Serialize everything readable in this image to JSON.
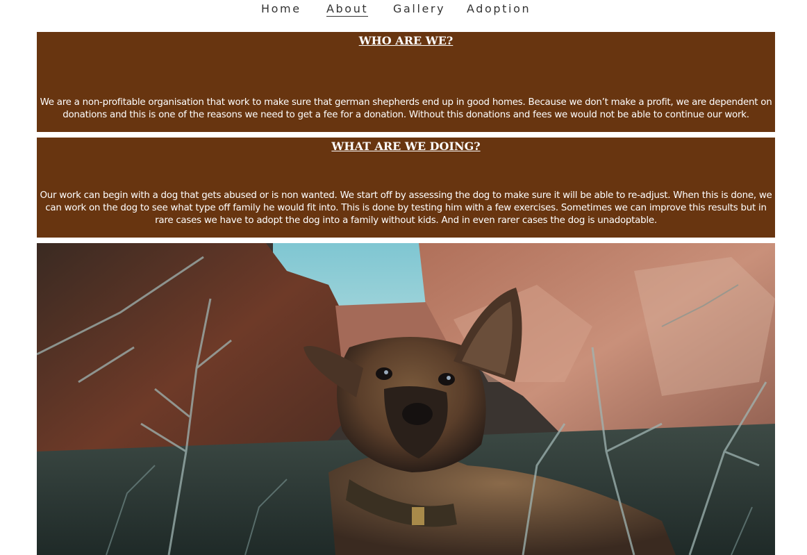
{
  "nav": {
    "items": [
      {
        "label": "Home"
      },
      {
        "label": "About"
      },
      {
        "label": "Gallery"
      },
      {
        "label": "Adoption"
      }
    ],
    "active": "About"
  },
  "sections": [
    {
      "heading": "WHO ARE WE?",
      "body": "We are a non-profitable organisation that work to make sure that german shepherds end up in good homes. Because we don’t make a profit, we are dependent on donations and this is one of the reasons we need to get a fee for a donation. Without this donations and fees we would not be able to continue our work."
    },
    {
      "heading": "WHAT ARE WE DOING?",
      "body": "Our work can begin with a dog that gets abused or is non wanted. We start off by assessing the dog to make sure it will be able to re-adjust. When this is done, we can work on the dog to see what type off family he would fit into. This is done by testing him with a few exercises. Sometimes we can improve this results but in rare cases we have to adopt the dog into a family without kids. And in even rarer cases the dog is unadoptable."
    }
  ],
  "colors": {
    "section_bg": "#683510",
    "section_text": "#ffffff",
    "nav_text": "#333333"
  }
}
